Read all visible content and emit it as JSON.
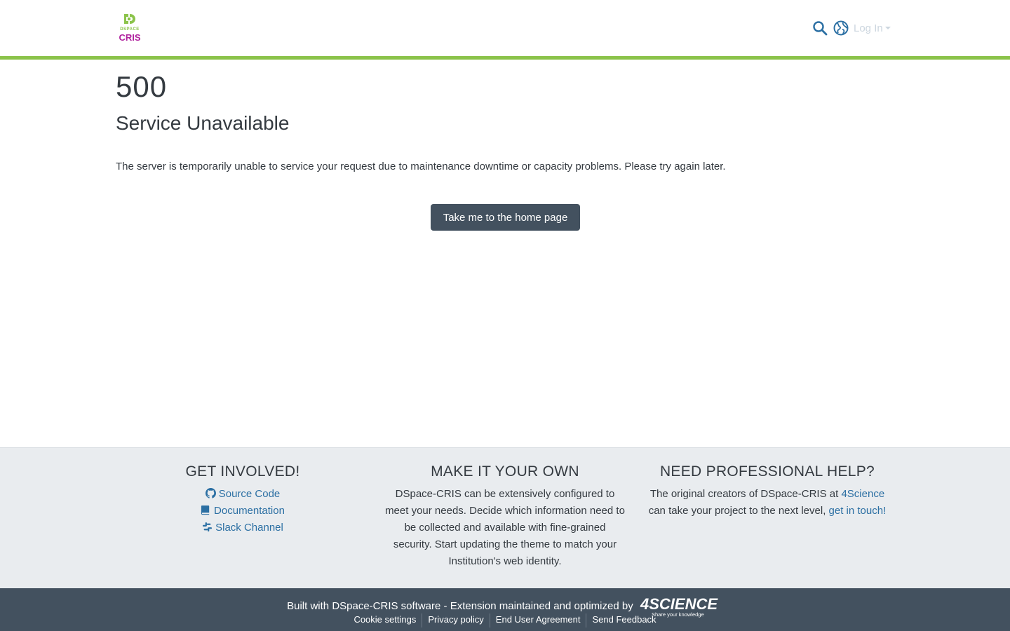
{
  "header": {
    "logo_top": "DSPACE",
    "logo_bottom": "CRIS",
    "login_label": "Log In",
    "search_icon": "search-icon",
    "language_icon": "globe-icon"
  },
  "main": {
    "error_code": "500",
    "error_title": "Service Unavailable",
    "error_message": "The server is temporarily unable to service your request due to maintenance downtime or capacity problems. Please try again later.",
    "home_button": "Take me to the home page"
  },
  "footer": {
    "get_involved": {
      "title": "GET INVOLVED!",
      "links": [
        "Source Code",
        "Documentation",
        "Slack Channel"
      ]
    },
    "make_it_your_own": {
      "title": "MAKE IT YOUR OWN",
      "text": "DSpace-CRIS can be extensively configured to meet your needs. Decide which information need to be collected and available with fine-grained security. Start updating the theme to match your Institution's web identity."
    },
    "professional_help": {
      "title": "NEED PROFESSIONAL HELP?",
      "text_before": "The original creators of DSpace-CRIS at ",
      "link_4science": "4Science",
      "text_middle": " can take your project to the next level, ",
      "link_contact": "get in touch!"
    },
    "built_prefix": "Built with ",
    "built_link": "DSpace-CRIS software",
    "built_suffix": " - Extension maintained and optimized by",
    "sci_logo_text": "4SCIENCE",
    "sci_logo_tagline": "Share your knowledge",
    "bottom_links": [
      "Cookie settings",
      "Privacy policy",
      "End User Agreement",
      "Send Feedback"
    ]
  },
  "colors": {
    "accent_green": "#8bc34a",
    "brand_magenta": "#b0229e",
    "link_blue": "#2b6fa3",
    "dark_slate": "#43515f",
    "footer_gray": "#e9ecef"
  }
}
